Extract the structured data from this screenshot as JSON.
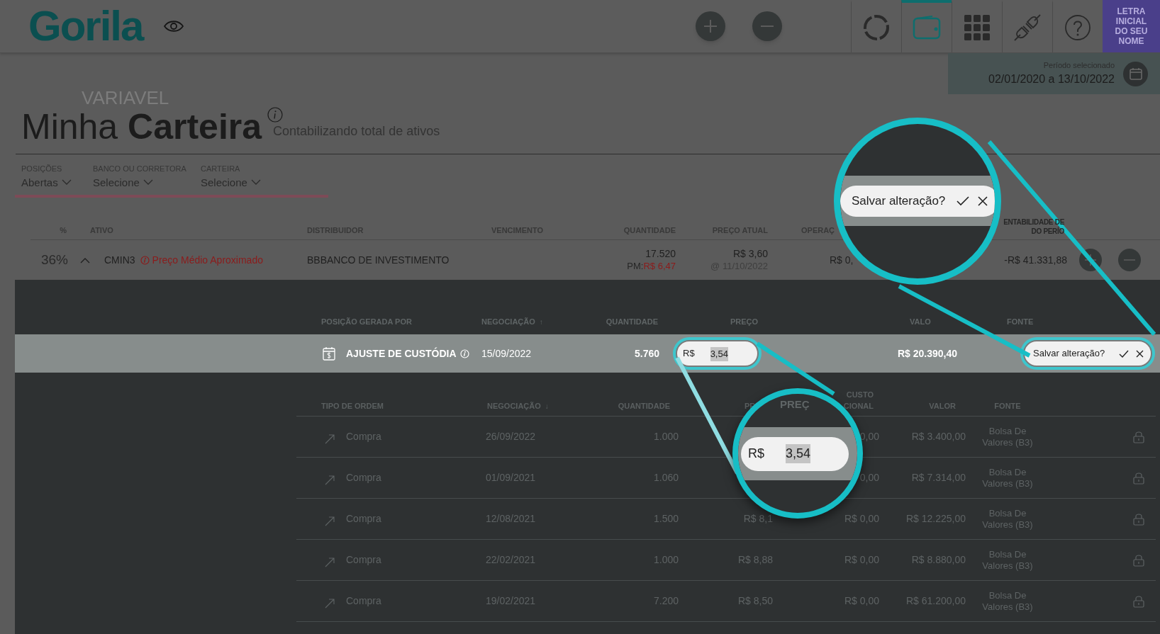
{
  "header": {
    "logo": "Gorila",
    "nav": [
      {
        "kind": "ring",
        "selected": false
      },
      {
        "kind": "wallet",
        "selected": true
      },
      {
        "kind": "grid",
        "selected": false
      },
      {
        "kind": "plug",
        "selected": false
      },
      {
        "kind": "help",
        "selected": false
      }
    ],
    "avatar": "LETRA INICIAL DO SEU NOME"
  },
  "period": {
    "label": "Período selecionado",
    "value": "02/01/2020 a 13/10/2022"
  },
  "ghost_tab": "VARIAVEL",
  "title": "Minha **Carteira**",
  "subtitle": "Contabilizando total de ativos",
  "filters": [
    {
      "label": "POSIÇÕES",
      "value": "Abertas"
    },
    {
      "label": "BANCO OU CORRETORA",
      "value": "Selecione"
    },
    {
      "label": "CARTEIRA",
      "value": "Selecione"
    }
  ],
  "positions": {
    "columns": [
      "%",
      "ATIVO",
      "DISTRIBUIDOR",
      "VENCIMENTO",
      "QUANTIDADE",
      "PREÇO ATUAL",
      "OPERAÇ",
      "ENTABILIDADE DE\nDO PERÍO"
    ],
    "row": {
      "share": "36%",
      "expanded": true,
      "asset": "CMIN3",
      "warning": "Preço Médio Aproximado",
      "distributor": "BBBANCO DE INVESTIMENTO",
      "quantity": "17.520",
      "pm_label": "PM:",
      "pm_value": "R$ 6,47",
      "price": "R$ 3,60",
      "price_date": "@ 11/10/2022",
      "column_7": "R$ 0,",
      "result": "-R$ 41.331,88"
    }
  },
  "origin": {
    "columns": [
      "POSIÇÃO GERADA POR",
      "NEGOCIAÇÃO",
      "QUANTIDADE",
      "PREÇO",
      "VALO",
      "FONTE"
    ],
    "sort_mark": "↑",
    "row": {
      "origin": "AJUSTE DE CUSTÓDIA",
      "date": "15/09/2022",
      "quantity": "5.760",
      "price_prefix": "R$",
      "price_value": "3,54",
      "value": "R$ 20.390,40",
      "confirm": "Salvar alteração?"
    }
  },
  "orders": {
    "columns": [
      "TIPO DE ORDEM",
      "NEGOCIAÇÃO",
      "QUANTIDADE",
      "PR",
      "CUSTO\nCIONAL",
      "VALOR",
      "FONTE"
    ],
    "sort_mark": "↓",
    "rows": [
      {
        "type": "Compra",
        "date": "26/09/2022",
        "quantity": "1.000",
        "cost": "0,00",
        "value": "R$ 3.400,00",
        "source": "Bolsa De Valores (B3)"
      },
      {
        "type": "Compra",
        "date": "01/09/2021",
        "quantity": "1.060",
        "cost": "0,00",
        "value": "R$ 7.314,00",
        "source": "Bolsa De Valores (B3)"
      },
      {
        "type": "Compra",
        "date": "12/08/2021",
        "quantity": "1.500",
        "price": "R$ 8,1",
        "cost": "R$ 0,00",
        "value": "R$ 12.225,00",
        "source": "Bolsa De Valores (B3)"
      },
      {
        "type": "Compra",
        "date": "22/02/2021",
        "quantity": "1.000",
        "price": "R$ 8,88",
        "cost": "R$ 0,00",
        "value": "R$ 8.880,00",
        "source": "Bolsa De Valores (B3)"
      },
      {
        "type": "Compra",
        "date": "19/02/2021",
        "quantity": "7.200",
        "price": "R$ 8,50",
        "cost": "R$ 0,00",
        "value": "R$ 61.200,00",
        "source": "Bolsa De Valores (B3)"
      }
    ]
  },
  "magnifiers": [
    {
      "kind": "confirm",
      "text": "Salvar alteração?"
    },
    {
      "kind": "price",
      "header": "PREÇ",
      "prefix": "R$",
      "value": "3,54"
    }
  ]
}
